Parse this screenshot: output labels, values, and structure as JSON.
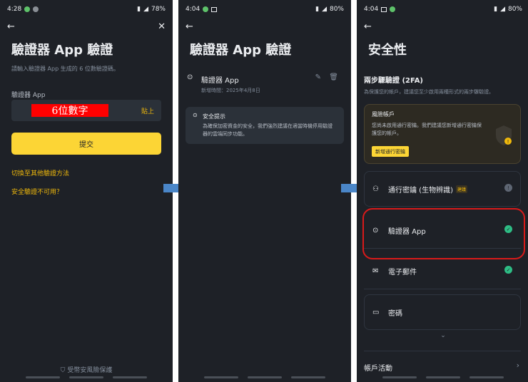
{
  "screen1": {
    "status": {
      "time": "4:28",
      "battery": "78%"
    },
    "title": "驗證器 App 驗證",
    "subtitle": "請輸入驗證器 App 生成的 6 位數驗證碼。",
    "field_label": "驗證器 App",
    "code_overlay": "6位數字",
    "paste_label": "貼上",
    "submit_label": "提交",
    "switch_link": "切換至其他驗證方法",
    "unavailable_link": "安全驗證不可用？",
    "footer": "受幣安風險保護"
  },
  "screen2": {
    "status": {
      "time": "4:04",
      "battery": "80%"
    },
    "title": "驗證器 App 驗證",
    "authenticator_name": "驗證器 App",
    "added_date": "新增時間：2025年4月8日",
    "tip_title": "安全提示",
    "tip_text": "為確保加密資金的安全，我們強烈建議在適當時機停用驗證器的雲端同步功能。"
  },
  "screen3": {
    "status": {
      "time": "4:04",
      "battery": "80%"
    },
    "title": "安全性",
    "section_title": "兩步驟驗證 (2FA)",
    "section_desc": "為保護您的帳戶，建議您至少啟用兩種形式的兩步驟驗證。",
    "risk_title": "風險帳戶",
    "risk_text": "您尚未啟用通行密鑰。我們建議您新增通行密鑰保護您的帳戶。",
    "risk_button": "新增通行密鑰",
    "items": [
      {
        "label": "通行密鑰 (生物辨識)",
        "badge": "建議",
        "status": "!"
      },
      {
        "label": "驗證器 App",
        "status": "✓"
      },
      {
        "label": "電子郵件",
        "status": "✓"
      },
      {
        "label": "密碼",
        "status": ""
      }
    ],
    "account_activity": "帳戶活動"
  },
  "colors": {
    "background": "#1e2127",
    "accent": "#fcd535",
    "link": "#f0b90b",
    "success": "#2ebd85",
    "highlight": "#d91a1a",
    "arrow": "#4a86c8"
  }
}
